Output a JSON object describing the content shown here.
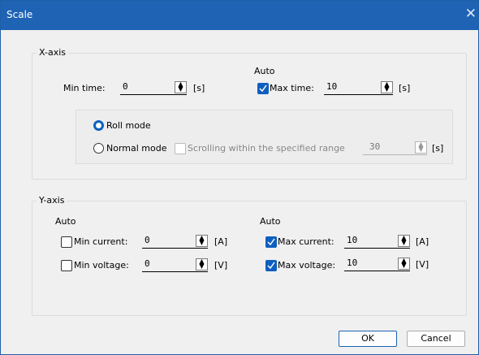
{
  "window": {
    "title": "Scale",
    "close_glyph": "✕"
  },
  "x_axis": {
    "legend": "X-axis",
    "auto_label": "Auto",
    "min_time": {
      "label": "Min time:",
      "value": "0",
      "unit": "[s]"
    },
    "max_time": {
      "label": "Max time:",
      "value": "10",
      "unit": "[s]",
      "auto_checked": true
    },
    "roll_mode": {
      "label": "Roll mode",
      "selected": true
    },
    "normal_mode": {
      "label": "Normal mode",
      "selected": false
    },
    "scrolling": {
      "label": "Scrolling within the specified range",
      "value": "30",
      "unit": "[s]",
      "checked": false,
      "enabled": false
    }
  },
  "y_axis": {
    "legend": "Y-axis",
    "auto_label_left": "Auto",
    "auto_label_right": "Auto",
    "min_current": {
      "label": "Min current:",
      "value": "0",
      "unit": "[A]",
      "auto_checked": false
    },
    "min_voltage": {
      "label": "Min voltage:",
      "value": "0",
      "unit": "[V]",
      "auto_checked": false
    },
    "max_current": {
      "label": "Max current:",
      "value": "10",
      "unit": "[A]",
      "auto_checked": true
    },
    "max_voltage": {
      "label": "Max voltage:",
      "value": "10",
      "unit": "[V]",
      "auto_checked": true
    }
  },
  "buttons": {
    "ok": "OK",
    "cancel": "Cancel"
  },
  "icons": {
    "spin": "spin-updown-icon",
    "check": "checkmark-icon",
    "close": "close-icon"
  }
}
